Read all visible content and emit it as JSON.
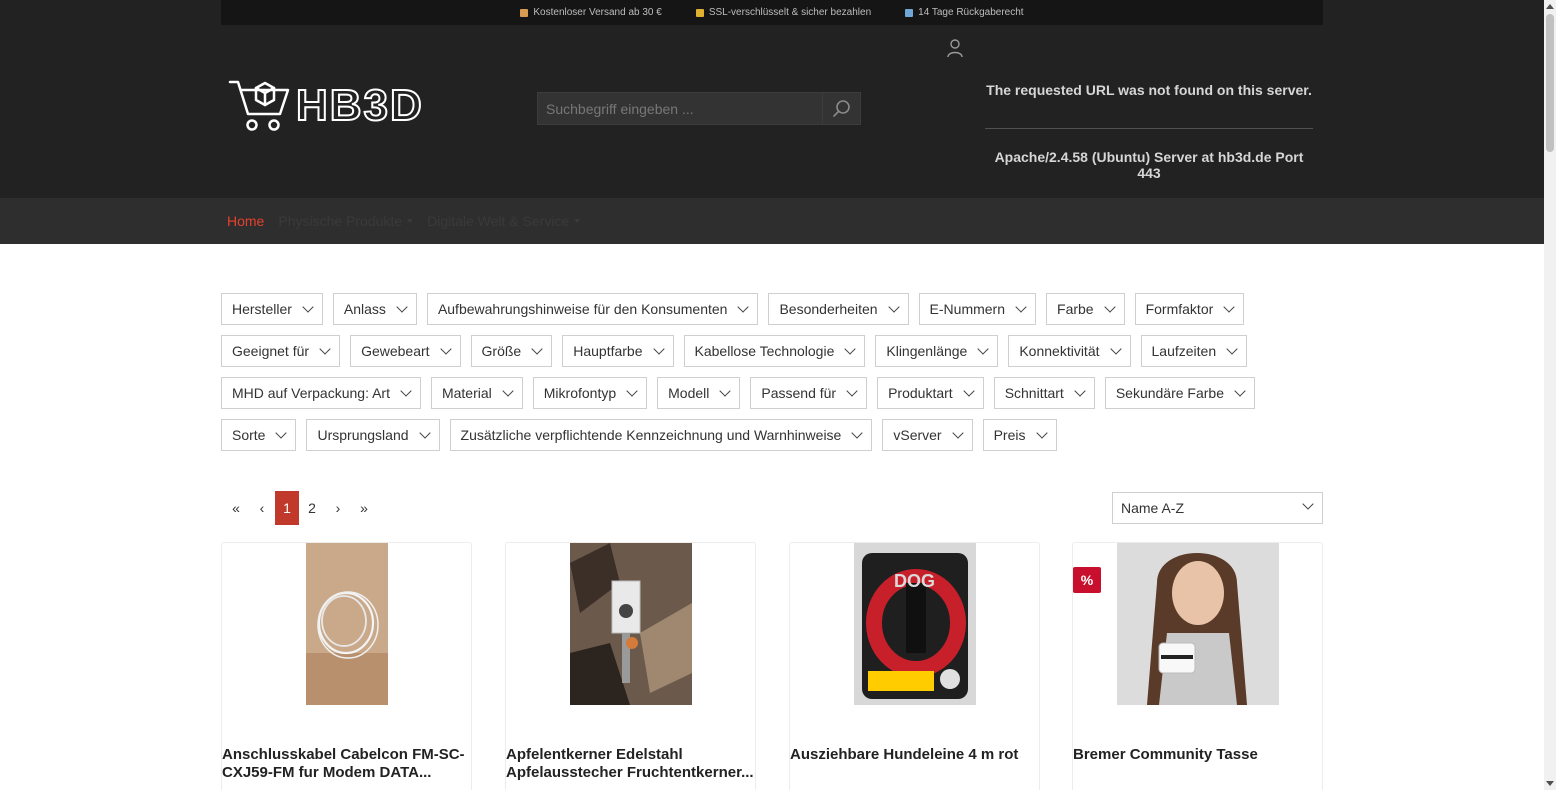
{
  "topbar": {
    "items": [
      {
        "icon": "package-icon",
        "text": "Kostenloser Versand ab 30 €"
      },
      {
        "icon": "lock-icon",
        "text": "SSL-verschlüsselt & sicher bezahlen"
      },
      {
        "icon": "calendar-icon",
        "text": "14 Tage Rückgaberecht"
      }
    ]
  },
  "logo": {
    "text": "HB3D"
  },
  "search": {
    "placeholder": "Suchbegriff eingeben ..."
  },
  "error": {
    "line1": "The requested URL was not found on this server.",
    "line2": "Apache/2.4.58 (Ubuntu) Server at hb3d.de Port 443"
  },
  "nav": {
    "home": "Home",
    "physical": "Physische Produkte",
    "digital": "Digitale Welt & Service"
  },
  "filters": {
    "row1": [
      "Hersteller",
      "Anlass",
      "Aufbewahrungshinweise für den Konsumenten",
      "Besonderheiten",
      "E-Nummern",
      "Farbe",
      "Formfaktor"
    ],
    "row2": [
      "Geeignet für",
      "Gewebeart",
      "Größe",
      "Hauptfarbe",
      "Kabellose Technologie",
      "Klingenlänge",
      "Konnektivität",
      "Laufzeiten"
    ],
    "row3": [
      "MHD auf Verpackung: Art",
      "Material",
      "Mikrofontyp",
      "Modell",
      "Passend für",
      "Produktart",
      "Schnittart",
      "Sekundäre Farbe"
    ],
    "row4": [
      "Sorte",
      "Ursprungsland",
      "Zusätzliche verpflichtende Kennzeichnung und Warnhinweise",
      "vServer",
      "Preis"
    ]
  },
  "pagination": {
    "first": "«",
    "prev": "‹",
    "pages": [
      "1",
      "2"
    ],
    "next": "›",
    "last": "»"
  },
  "sort": {
    "selected": "Name A-Z"
  },
  "products": [
    {
      "title": "Anschlusskabel Cabelcon FM-SC-CXJ59-FM fur Modem DATA..."
    },
    {
      "title": "Apfelentkerner Edelstahl Apfelausstecher Fruchtentkerner..."
    },
    {
      "title": "Ausziehbare Hundeleine 4 m rot"
    },
    {
      "title": "Bremer Community Tasse",
      "badge": "%"
    }
  ],
  "colors": {
    "accent": "#e7402c",
    "badge": "#c8102e",
    "active_page": "#c0392b"
  }
}
